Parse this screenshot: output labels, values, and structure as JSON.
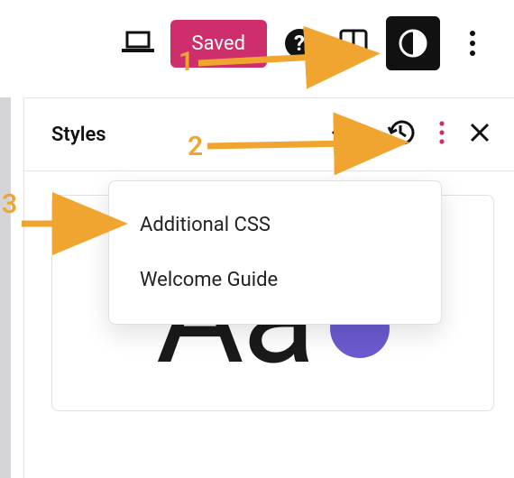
{
  "toolbar": {
    "saved_label": "Saved"
  },
  "panel": {
    "title": "Styles",
    "sample_text": "Aa"
  },
  "menu": {
    "items": [
      "Additional CSS",
      "Welcome Guide"
    ]
  },
  "annotations": {
    "a1": "1",
    "a2": "2",
    "a3": "3"
  },
  "colors": {
    "accent_pink": "#cf2e6c",
    "accent_purple": "#6a5bcf",
    "arrow": "#f0a530"
  }
}
